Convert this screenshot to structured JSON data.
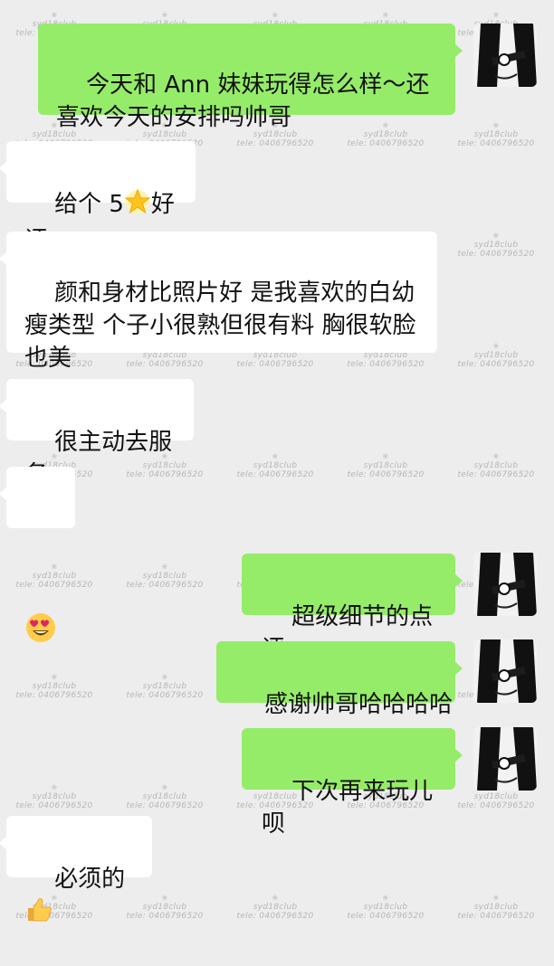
{
  "watermark": {
    "site": "syd18club",
    "phone": "tele: 0406796520"
  },
  "messages": [
    {
      "side": "outgoing",
      "text": "今天和 Ann 妹妹玩得怎么样～还喜欢今天的安排吗帅哥"
    },
    {
      "side": "incoming",
      "text_before": "给个 5",
      "emoji": "glowing-star",
      "text_after": "好评"
    },
    {
      "side": "incoming",
      "text": "颜和身材比照片好 是我喜欢的白幼瘦类型 个子小很熟但很有料 胸很软脸也美"
    },
    {
      "side": "incoming",
      "text": "很主动去服务"
    },
    {
      "side": "incoming",
      "emoji": "smiling-face-with-heart-eyes"
    },
    {
      "side": "outgoing",
      "text": "超级细节的点评"
    },
    {
      "side": "outgoing",
      "text": "感谢帅哥哈哈哈哈"
    },
    {
      "side": "outgoing",
      "text": "下次再来玩儿呗"
    },
    {
      "side": "incoming",
      "text": "必须的",
      "emoji": "thumbs-up"
    }
  ],
  "colors": {
    "background": "#ededed",
    "outgoing_bubble": "#95ec69",
    "incoming_bubble": "#ffffff"
  }
}
